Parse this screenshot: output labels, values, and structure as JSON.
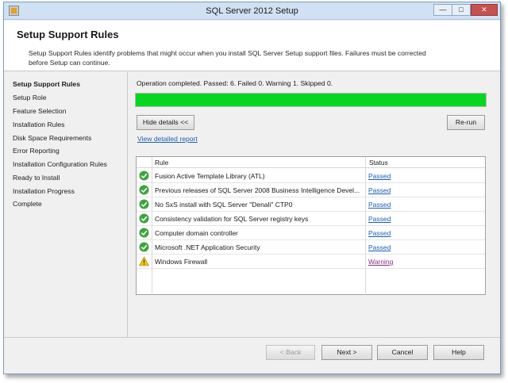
{
  "window": {
    "title": "SQL Server 2012 Setup",
    "min_label": "—",
    "max_label": "□",
    "close_label": "✕"
  },
  "header": {
    "title": "Setup Support Rules",
    "description": "Setup Support Rules identify problems that might occur when you install SQL Server Setup support files. Failures must be corrected before Setup can continue."
  },
  "sidebar": {
    "items": [
      {
        "label": "Setup Support Rules",
        "active": true
      },
      {
        "label": "Setup Role",
        "active": false
      },
      {
        "label": "Feature Selection",
        "active": false
      },
      {
        "label": "Installation Rules",
        "active": false
      },
      {
        "label": "Disk Space Requirements",
        "active": false
      },
      {
        "label": "Error Reporting",
        "active": false
      },
      {
        "label": "Installation Configuration Rules",
        "active": false
      },
      {
        "label": "Ready to Install",
        "active": false
      },
      {
        "label": "Installation Progress",
        "active": false
      },
      {
        "label": "Complete",
        "active": false
      }
    ]
  },
  "main": {
    "operation_status": "Operation completed. Passed: 6.   Failed 0.   Warning 1.   Skipped 0.",
    "progress_fraction": 1.0,
    "progress_color": "#06d61f",
    "hide_details_label": "Hide details <<",
    "rerun_label": "Re-run",
    "view_report_label": "View detailed report",
    "table": {
      "col_rule": "Rule",
      "col_status": "Status",
      "rows": [
        {
          "icon": "check-icon",
          "rule": "Fusion Active Template Library (ATL)",
          "status": "Passed"
        },
        {
          "icon": "check-icon",
          "rule": "Previous releases of SQL Server 2008 Business Intelligence Devel...",
          "status": "Passed"
        },
        {
          "icon": "check-icon",
          "rule": "No SxS install with SQL Server \"Denali\" CTP0",
          "status": "Passed"
        },
        {
          "icon": "check-icon",
          "rule": "Consistency validation for SQL Server registry keys",
          "status": "Passed"
        },
        {
          "icon": "check-icon",
          "rule": "Computer domain controller",
          "status": "Passed"
        },
        {
          "icon": "check-icon",
          "rule": "Microsoft .NET Application Security",
          "status": "Passed"
        },
        {
          "icon": "warning-icon",
          "rule": "Windows Firewall",
          "status": "Warning"
        }
      ]
    }
  },
  "footer": {
    "back_label": "< Back",
    "next_label": "Next >",
    "cancel_label": "Cancel",
    "help_label": "Help"
  },
  "colors": {
    "pass": "#3aa63a",
    "warning": "#f1c40f"
  }
}
